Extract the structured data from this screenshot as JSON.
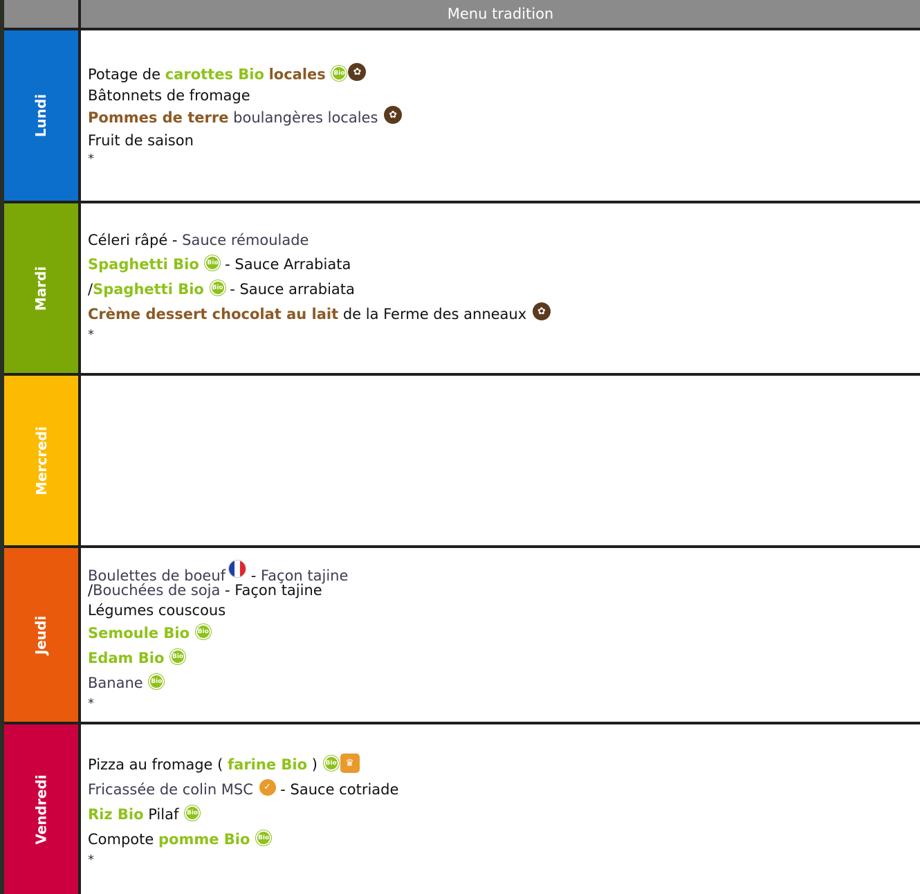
{
  "header": {
    "title": "Menu tradition"
  },
  "colors": {
    "lundi": "#0d6fcc",
    "mardi": "#7ba807",
    "mercredi": "#fcbb00",
    "jeudi": "#e95a0c",
    "vendredi": "#cc003f",
    "bio_text": "#8ec21a",
    "local_text": "#8c5a24"
  },
  "icons": {
    "bio": "bio-label-icon",
    "local": "local-product-icon",
    "flag": "france-flag-icon",
    "msc": "msc-label-icon",
    "chef": "homemade-chef-icon"
  },
  "days": {
    "lundi": {
      "label": "Lundi",
      "line1": {
        "a": "Potage de ",
        "b": "carottes Bio",
        "c": " ",
        "d": "locales"
      },
      "line2": "Bâtonnets de fromage",
      "line3": {
        "a": "Pommes de terre",
        "b": " boulangères locales"
      },
      "line4": "Fruit de saison",
      "star": "*"
    },
    "mardi": {
      "label": "Mardi",
      "line1": {
        "a": "Céleri râpé",
        "b": " - ",
        "c": "Sauce rémoulade"
      },
      "line2": {
        "a": "Spaghetti Bio",
        "b": " - Sauce Arrabiata"
      },
      "line3": {
        "a": "/",
        "b": "Spaghetti Bio",
        "c": " - Sauce arrabiata"
      },
      "line4": {
        "a": "Crème dessert chocolat au lait",
        "b": " de la Ferme des anneaux"
      },
      "star": "*"
    },
    "mercredi": {
      "label": "Mercredi"
    },
    "jeudi": {
      "label": "Jeudi",
      "line1": {
        "a": "Boulettes de boeuf",
        "b": " - ",
        "c": "Façon tajine"
      },
      "line2": {
        "a": "/",
        "b": "Bouchées de soja",
        "c": " - Façon tajine"
      },
      "line3": "Légumes couscous",
      "line4": "Semoule Bio",
      "line5": "Edam Bio",
      "line6": "Banane",
      "star": "*"
    },
    "vendredi": {
      "label": "Vendredi",
      "line1": {
        "a": "Pizza au fromage ( ",
        "b": "farine Bio",
        "c": " )"
      },
      "line2": {
        "a": "Fricassée de colin MSC",
        "b": " - Sauce cotriade"
      },
      "line3": {
        "a": "Riz Bio",
        "b": " Pilaf"
      },
      "line4": {
        "a": "Compote ",
        "b": "pomme Bio"
      },
      "star": "*"
    }
  }
}
